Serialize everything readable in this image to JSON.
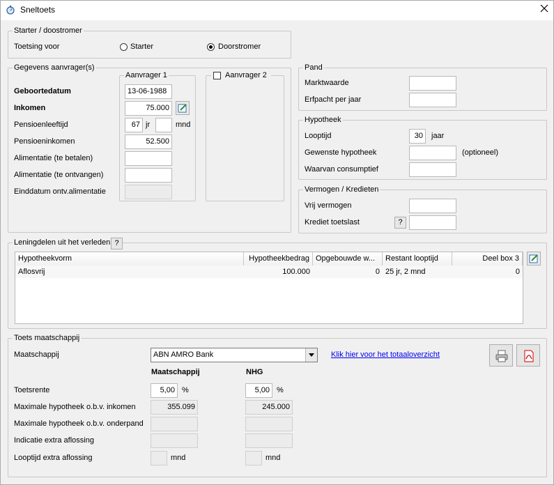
{
  "window": {
    "title": "Sneltoets"
  },
  "starter": {
    "legend": "Starter / doostromer",
    "toetsing_label": "Toetsing voor",
    "option_starter": "Starter",
    "option_doorstromer": "Doorstromer",
    "selected": "Doorstromer"
  },
  "aanvragers": {
    "legend": "Gegevens aanvrager(s)",
    "labels": {
      "geboortedatum": "Geboortedatum",
      "inkomen": "Inkomen",
      "pensioenleeftijd": "Pensioenleeftijd",
      "pensioeninkomen": "Pensioeninkomen",
      "alimentatie_betalen": "Alimentatie (te betalen)",
      "alimentatie_ontvangen": "Alimentatie (te ontvangen)",
      "einddatum": "Einddatum ontv.alimentatie"
    },
    "aanvrager1": {
      "legend": "Aanvrager 1",
      "geboortedatum": "13-06-1988",
      "inkomen": "75.000",
      "pensioenleeftijd_jr": "67",
      "jr_unit": "jr",
      "pensioenleeftijd_mnd": "",
      "mnd_unit": "mnd",
      "pensioeninkomen": "52.500",
      "alimentatie_betalen": "",
      "alimentatie_ontvangen": "",
      "einddatum": ""
    },
    "aanvrager2": {
      "legend": "Aanvrager 2",
      "checked": false
    }
  },
  "pand": {
    "legend": "Pand",
    "marktwaarde_label": "Marktwaarde",
    "marktwaarde": "",
    "erfpacht_label": "Erfpacht per jaar",
    "erfpacht": ""
  },
  "hypotheek": {
    "legend": "Hypotheek",
    "looptijd_label": "Looptijd",
    "looptijd": "30",
    "looptijd_unit": "jaar",
    "gewenste_label": "Gewenste hypotheek",
    "gewenste": "",
    "optioneel": "(optioneel)",
    "consumptief_label": "Waarvan consumptief",
    "consumptief": ""
  },
  "vermogen": {
    "legend": "Vermogen / Kredieten",
    "vrij_label": "Vrij vermogen",
    "vrij": "",
    "krediet_label": "Krediet toetslast",
    "krediet_help": "?",
    "krediet": ""
  },
  "leningdelen": {
    "legend": "Leningdelen uit het verleden",
    "help": "?",
    "columns": [
      "Hypotheekvorm",
      "Hypotheekbedrag",
      "Opgebouwde w...",
      "Restant looptijd",
      "Deel box 3"
    ],
    "rows": [
      [
        "Aflosvrij",
        "100.000",
        "0",
        "25 jr, 2 mnd",
        "0"
      ]
    ]
  },
  "toets": {
    "legend": "Toets maatschappij",
    "maatschappij_label": "Maatschappij",
    "maatschappij_value": "ABN AMRO Bank",
    "link": "Klik hier voor het totaaloverzicht",
    "col_maatschappij": "Maatschappij",
    "col_nhg": "NHG",
    "toetsrente_label": "Toetsrente",
    "toetsrente_m": "5,00",
    "toetsrente_n": "5,00",
    "percent": "%",
    "max_inkomen_label": "Maximale hypotheek o.b.v. inkomen",
    "max_inkomen_m": "355.099",
    "max_inkomen_n": "245.000",
    "max_onderpand_label": "Maximale hypotheek o.b.v. onderpand",
    "max_onderpand_m": "",
    "max_onderpand_n": "",
    "indicatie_label": "Indicatie extra aflossing",
    "indicatie_m": "",
    "indicatie_n": "",
    "looptijd_extra_label": "Looptijd extra aflossing",
    "looptijd_extra_m": "",
    "looptijd_extra_n": "",
    "mnd": "mnd"
  }
}
